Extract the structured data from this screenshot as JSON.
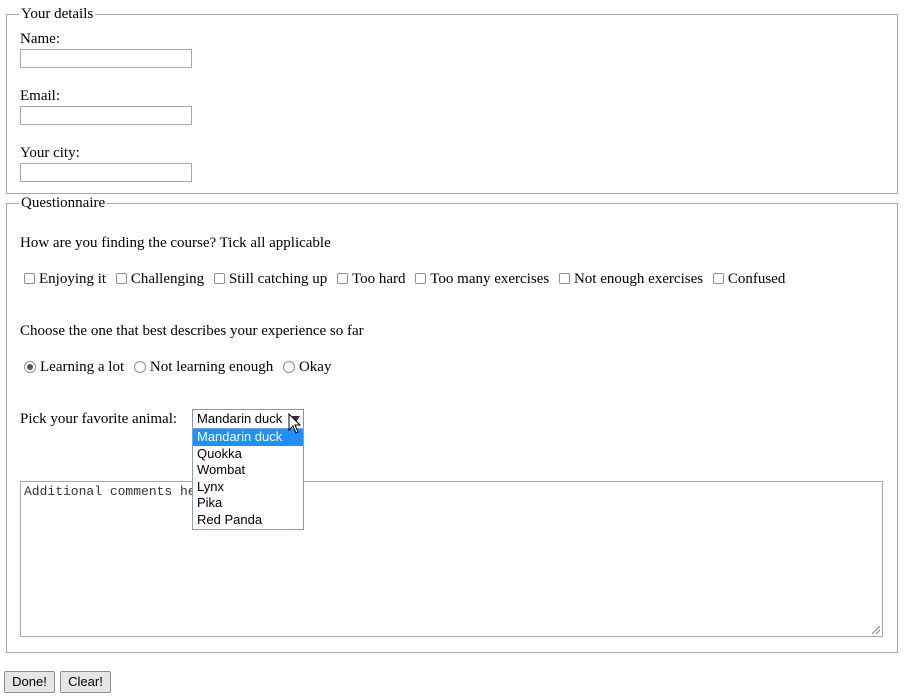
{
  "details": {
    "legend": "Your details",
    "name_label": "Name:",
    "name_value": "",
    "email_label": "Email:",
    "email_value": "",
    "city_label": "Your city:",
    "city_value": ""
  },
  "questionnaire": {
    "legend": "Questionnaire",
    "q1": "How are you finding the course? Tick all applicable",
    "checkboxes": [
      {
        "label": "Enjoying it",
        "checked": false
      },
      {
        "label": "Challenging",
        "checked": false
      },
      {
        "label": "Still catching up",
        "checked": false
      },
      {
        "label": "Too hard",
        "checked": false
      },
      {
        "label": "Too many exercises",
        "checked": false
      },
      {
        "label": "Not enough exercises",
        "checked": false
      },
      {
        "label": "Confused",
        "checked": false
      }
    ],
    "q2": "Choose the one that best describes your experience so far",
    "radios": [
      {
        "label": "Learning a lot",
        "checked": true
      },
      {
        "label": "Not learning enough",
        "checked": false
      },
      {
        "label": "Okay",
        "checked": false
      }
    ],
    "animal_label": "Pick your favorite animal:",
    "animal_selected": "Mandarin duck",
    "animal_options": [
      "Mandarin duck",
      "Quokka",
      "Wombat",
      "Lynx",
      "Pika",
      "Red Panda"
    ],
    "comments_placeholder": "Additional comments here"
  },
  "buttons": {
    "done": "Done!",
    "clear": "Clear!"
  },
  "colors": {
    "selected_option_bg": "#1e90ff",
    "select_border": "#6e9ad8"
  }
}
